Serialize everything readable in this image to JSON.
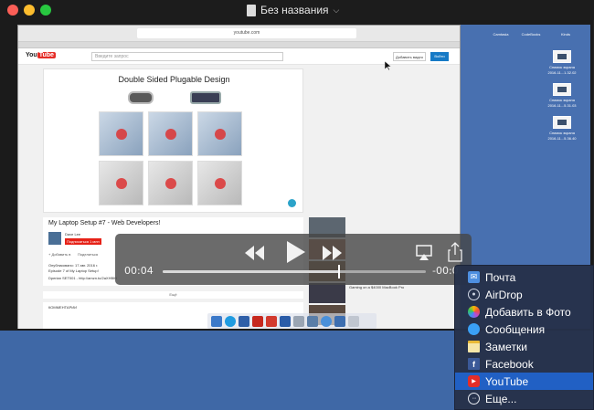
{
  "window": {
    "title": "Без названия",
    "chevron_icon": "chevron-down-icon"
  },
  "browser": {
    "url": "youtube.com",
    "youtube": {
      "logo_text": "You",
      "logo_tube": "Tube",
      "search_placeholder": "Введите запрос",
      "add_video": "Добавить видео",
      "sign_in": "Войти"
    },
    "video": {
      "image_title": "Double Sided Plugable Design",
      "heading": "My Laptop Setup #7 - Web Developers!",
      "channel": "Dave Lee",
      "subscribe": "Подписаться 1 млн",
      "add_to": "+ Добавить в",
      "share": "Поделиться",
      "desc_lines": [
        "Опубликовано: 17 авг. 2016 г.",
        "Episode 7 of My Laptop Setup!",
        "Dperian SET001 - http://amzn.to/2aXHBIH"
      ],
      "more": "Ещё",
      "comments_label": "КОММЕНТАРИИ"
    },
    "sidebar_videos": [
      {
        "title": "",
        "sub": ""
      },
      {
        "title": "",
        "sub": ""
      },
      {
        "title": "",
        "sub": ""
      },
      {
        "title": "Gaming on a $4000 MacBook Pro",
        "sub": ""
      },
      {
        "title": "",
        "sub": ""
      }
    ]
  },
  "desktop": {
    "top_labels": [
      "",
      "Cаmtasia",
      "CodeBooks",
      "Kinds"
    ],
    "screenshots": [
      {
        "line1": "Снимок экрана",
        "line2": "2016-11...1.32.02"
      },
      {
        "line1": "Снимок экрана",
        "line2": "2016-11...5.31.03"
      },
      {
        "line1": "Снимок экрана",
        "line2": "2016-11...5.36.40"
      }
    ]
  },
  "player": {
    "elapsed": "00:04",
    "remaining": "-00:0",
    "progress_fraction": 0.67
  },
  "share_menu": {
    "items": [
      {
        "label": "Почта",
        "icon": "mail-icon",
        "selected": false
      },
      {
        "label": "AirDrop",
        "icon": "airdrop-icon",
        "selected": false
      },
      {
        "label": "Добавить в Фото",
        "icon": "photos-icon",
        "selected": false
      },
      {
        "label": "Сообщения",
        "icon": "messages-icon",
        "selected": false
      },
      {
        "label": "Заметки",
        "icon": "notes-icon",
        "selected": false
      },
      {
        "label": "Facebook",
        "icon": "facebook-icon",
        "selected": false
      },
      {
        "label": "YouTube",
        "icon": "youtube-icon",
        "selected": true
      },
      {
        "label": "Еще...",
        "icon": "more-icon",
        "selected": false
      }
    ]
  },
  "colors": {
    "desktop_blue": "#3f68a6",
    "menu_bg": "#26324a",
    "menu_selected": "#2160c4",
    "youtube_red": "#e52d27"
  }
}
